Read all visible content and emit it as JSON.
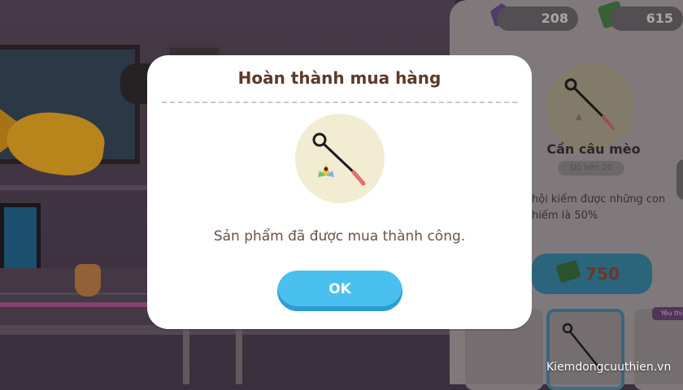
{
  "currency": {
    "gems": "208",
    "cash": "615"
  },
  "shop_item": {
    "name": "Cần câu mèo",
    "durability": "Độ bền 20",
    "description": "hội kiếm được những con\nhiếm là 50%",
    "price": "750",
    "thumb_tag": "Yêu thí"
  },
  "modal": {
    "title": "Hoàn thành mua hàng",
    "message": "Sản phẩm đã được mua thành công.",
    "ok_label": "OK"
  },
  "watermark": "Kiemdongcuuthien.vn"
}
